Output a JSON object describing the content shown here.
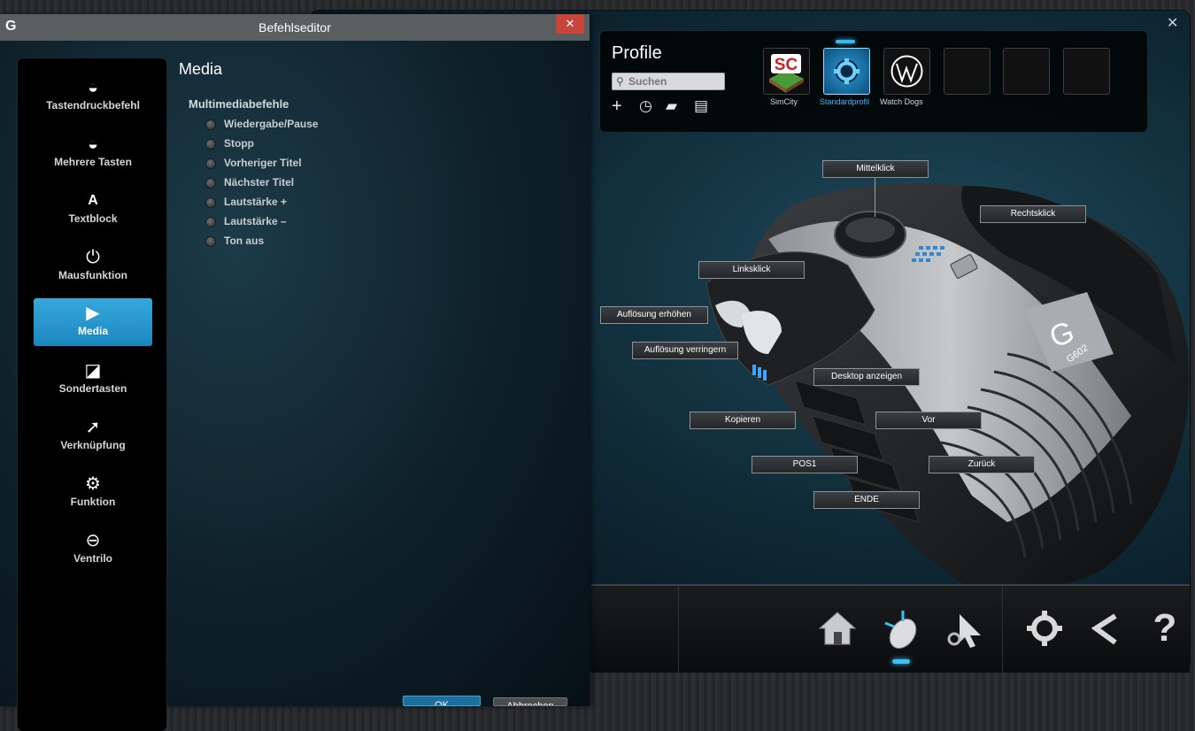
{
  "dialog": {
    "title": "Befehlseditor",
    "close_glyph": "✕",
    "categories": [
      {
        "label": "Tastendruckbefehl",
        "icon": "◒"
      },
      {
        "label": "Mehrere Tasten",
        "icon": "◒"
      },
      {
        "label": "Textblock",
        "icon": "A"
      },
      {
        "label": "Mausfunktion",
        "icon": "⏻"
      },
      {
        "label": "Media",
        "icon": "▶"
      },
      {
        "label": "Sondertasten",
        "icon": "◪"
      },
      {
        "label": "Verknüpfung",
        "icon": "➚"
      },
      {
        "label": "Funktion",
        "icon": "⚙"
      },
      {
        "label": "Ventrilo",
        "icon": "⊖"
      }
    ],
    "active_category": "Media",
    "heading": "Media",
    "group_label": "Multimediabefehle",
    "options": [
      "Wiedergabe/Pause",
      "Stopp",
      "Vorheriger Titel",
      "Nächster Titel",
      "Lautstärke +",
      "Lautstärke –",
      "Ton aus"
    ],
    "ok_label": "OK",
    "cancel_label": "Abbrechen"
  },
  "main": {
    "close_glyph": "✕",
    "profiles": {
      "title": "Profile",
      "search_placeholder": "Suchen",
      "slots": [
        {
          "label": "SimCity",
          "icon": "simcity-logo"
        },
        {
          "label": "Standardprofil",
          "icon": "gear-icon",
          "active": true
        },
        {
          "label": "Watch Dogs",
          "icon": "watchdogs-logo"
        },
        {
          "label": "",
          "icon": "empty"
        },
        {
          "label": "",
          "icon": "empty"
        },
        {
          "label": "",
          "icon": "empty"
        }
      ]
    },
    "callouts": {
      "mittelklick": "Mittelklick",
      "rechtsklick": "Rechtsklick",
      "linksklick": "Linksklick",
      "aufloesung_erhoehen": "Auflösung erhöhen",
      "aufloesung_verringern": "Auflösung verringern",
      "desktop_anzeigen": "Desktop anzeigen",
      "kopieren": "Kopieren",
      "vor": "Vor",
      "pos1": "POS1",
      "zurueck": "Zurück",
      "ende": "ENDE"
    },
    "mouse_model": "G602",
    "bottom_nav": [
      "home-icon",
      "customize-mouse-icon",
      "pointer-settings-icon",
      "settings-icon",
      "share-icon",
      "help-icon"
    ],
    "active_nav": "customize-mouse-icon"
  },
  "colors": {
    "accent": "#35a8dc",
    "close_red": "#c7453a"
  }
}
